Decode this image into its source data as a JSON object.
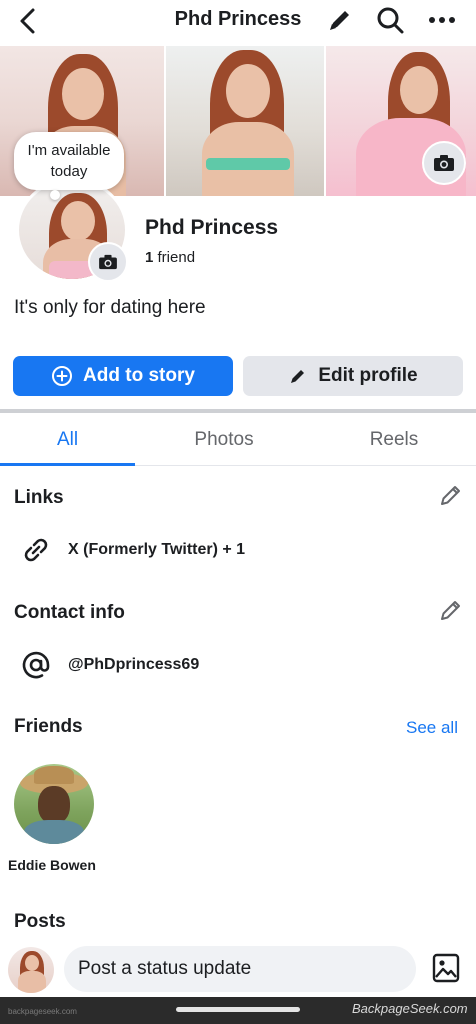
{
  "header": {
    "title": "Phd Princess",
    "icons": [
      "back-arrow-icon",
      "pencil-icon",
      "search-icon",
      "more-icon"
    ]
  },
  "status_bubble": "I'm available today",
  "profile": {
    "name": "Phd Princess",
    "friend_count": "1",
    "friend_label": "friend",
    "bio": "It's only for dating here"
  },
  "actions": {
    "add_story": "Add to story",
    "edit_profile": "Edit profile"
  },
  "tabs": [
    {
      "label": "All",
      "active": true
    },
    {
      "label": "Photos",
      "active": false
    },
    {
      "label": "Reels",
      "active": false
    }
  ],
  "links": {
    "heading": "Links",
    "item": "X (Formerly Twitter) + 1"
  },
  "contact": {
    "heading": "Contact info",
    "item": "@PhDprincess69"
  },
  "friends": {
    "heading": "Friends",
    "see_all": "See all",
    "list": [
      {
        "name": "Eddie Bowen"
      }
    ]
  },
  "posts": {
    "heading": "Posts",
    "composer_placeholder": "Post a status update"
  },
  "watermark": {
    "left": "backpageseek.com",
    "right": "BackpageSeek.com"
  },
  "colors": {
    "accent": "#1877f2",
    "secondary_button": "#e4e6eb",
    "text": "#1c1e21",
    "muted": "#65676b"
  }
}
